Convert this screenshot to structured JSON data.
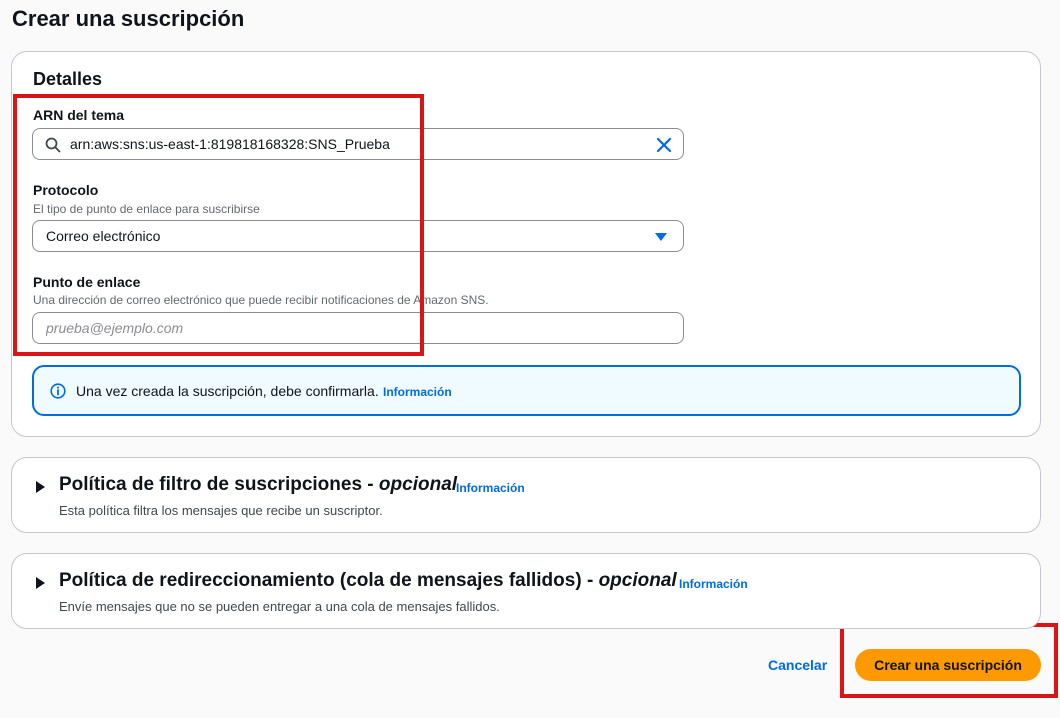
{
  "page": {
    "title": "Crear una suscripción"
  },
  "details": {
    "heading": "Detalles",
    "topic_arn": {
      "label": "ARN del tema",
      "value": "arn:aws:sns:us-east-1:819818168328:SNS_Prueba"
    },
    "protocol": {
      "label": "Protocolo",
      "description": "El tipo de punto de enlace para suscribirse",
      "selected": "Correo electrónico"
    },
    "endpoint": {
      "label": "Punto de enlace",
      "description": "Una dirección de correo electrónico que puede recibir notificaciones de Amazon SNS.",
      "placeholder": "prueba@ejemplo.com",
      "value": ""
    },
    "alert": {
      "text": "Una vez creada la suscripción, debe confirmarla.",
      "link": "Información"
    }
  },
  "filter_policy": {
    "title": "Política de filtro de suscripciones",
    "separator": " - ",
    "optional": "opcional",
    "link": "Información",
    "description": "Esta política filtra los mensajes que recibe un suscriptor."
  },
  "redrive_policy": {
    "title": "Política de redireccionamiento (cola de mensajes fallidos)",
    "separator": " - ",
    "optional": "opcional",
    "link": "Información",
    "description": "Envíe mensajes que no se pueden entregar a una cola de mensajes fallidos."
  },
  "actions": {
    "cancel": "Cancelar",
    "create": "Crear una suscripción"
  },
  "colors": {
    "accent": "#006ce0",
    "primary_button": "#ff9900",
    "highlight": "#d91515"
  },
  "icons": {
    "search": "search-icon",
    "clear": "close-icon",
    "dropdown": "caret-down-icon",
    "info": "info-icon",
    "expand": "caret-right-icon"
  }
}
